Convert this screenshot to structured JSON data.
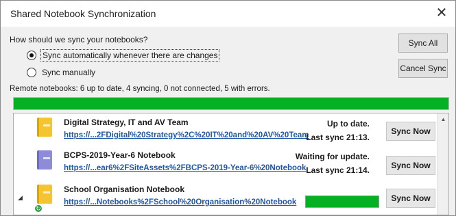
{
  "window": {
    "title": "Shared Notebook Synchronization",
    "close_glyph": "✕"
  },
  "sync_options": {
    "question": "How should we sync your notebooks?",
    "auto_label": "Sync automatically whenever there are changes",
    "manual_label": "Sync manually",
    "selected": "auto"
  },
  "buttons": {
    "sync_all": "Sync All",
    "cancel_sync": "Cancel Sync",
    "sync_now": "Sync Now"
  },
  "summary": {
    "text": "Remote notebooks: 6 up to date, 4 syncing, 0 not connected, 5 with errors.",
    "progress": 1.0,
    "progress_color": "#06b025"
  },
  "notebooks": [
    {
      "name": "Digital Strategy, IT and AV Team",
      "link": "https://...2FDigital%20Strategy%2C%20IT%20and%20AV%20Team",
      "state": "Up to date.",
      "last_sync": "Last sync 21:13.",
      "icon": "yellow-notebook-icon",
      "color": "#f5c531"
    },
    {
      "name": "BCPS-2019-Year-6 Notebook",
      "link": "https://...ear6%2FSiteAssets%2FBCPS-2019-Year-6%20Notebook",
      "state": "Waiting for update.",
      "last_sync": "Last sync 21:14.",
      "icon": "purple-notebook-icon",
      "color": "#8e8cd8"
    },
    {
      "name": "School Organisation Notebook",
      "link": "https://...Notebooks%2FSchool%20Organisation%20Notebook",
      "state": "",
      "last_sync": "",
      "icon": "yellow-notebook-icon",
      "color": "#f5c531",
      "syncing": true
    }
  ]
}
